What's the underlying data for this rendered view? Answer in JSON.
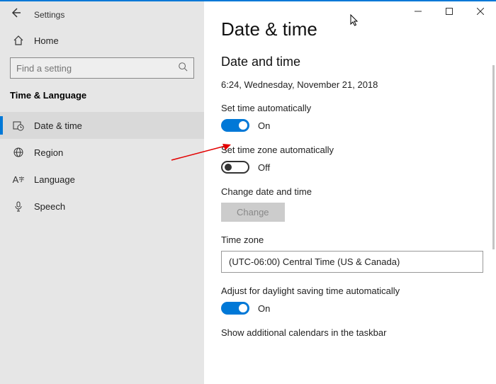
{
  "window": {
    "title": "Settings"
  },
  "sidebar": {
    "home_label": "Home",
    "search_placeholder": "Find a setting",
    "section_label": "Time & Language",
    "items": [
      {
        "label": "Date & time"
      },
      {
        "label": "Region"
      },
      {
        "label": "Language"
      },
      {
        "label": "Speech"
      }
    ]
  },
  "main": {
    "page_title": "Date & time",
    "subheading": "Date and time",
    "current_datetime": "6:24, Wednesday, November 21, 2018",
    "set_time_auto": {
      "label": "Set time automatically",
      "state": "On"
    },
    "set_tz_auto": {
      "label": "Set time zone automatically",
      "state": "Off"
    },
    "change_dt": {
      "label": "Change date and time",
      "button": "Change"
    },
    "timezone": {
      "label": "Time zone",
      "value": "(UTC-06:00) Central Time (US & Canada)"
    },
    "dst": {
      "label": "Adjust for daylight saving time automatically",
      "state": "On"
    },
    "additional_cal": {
      "label": "Show additional calendars in the taskbar"
    }
  }
}
